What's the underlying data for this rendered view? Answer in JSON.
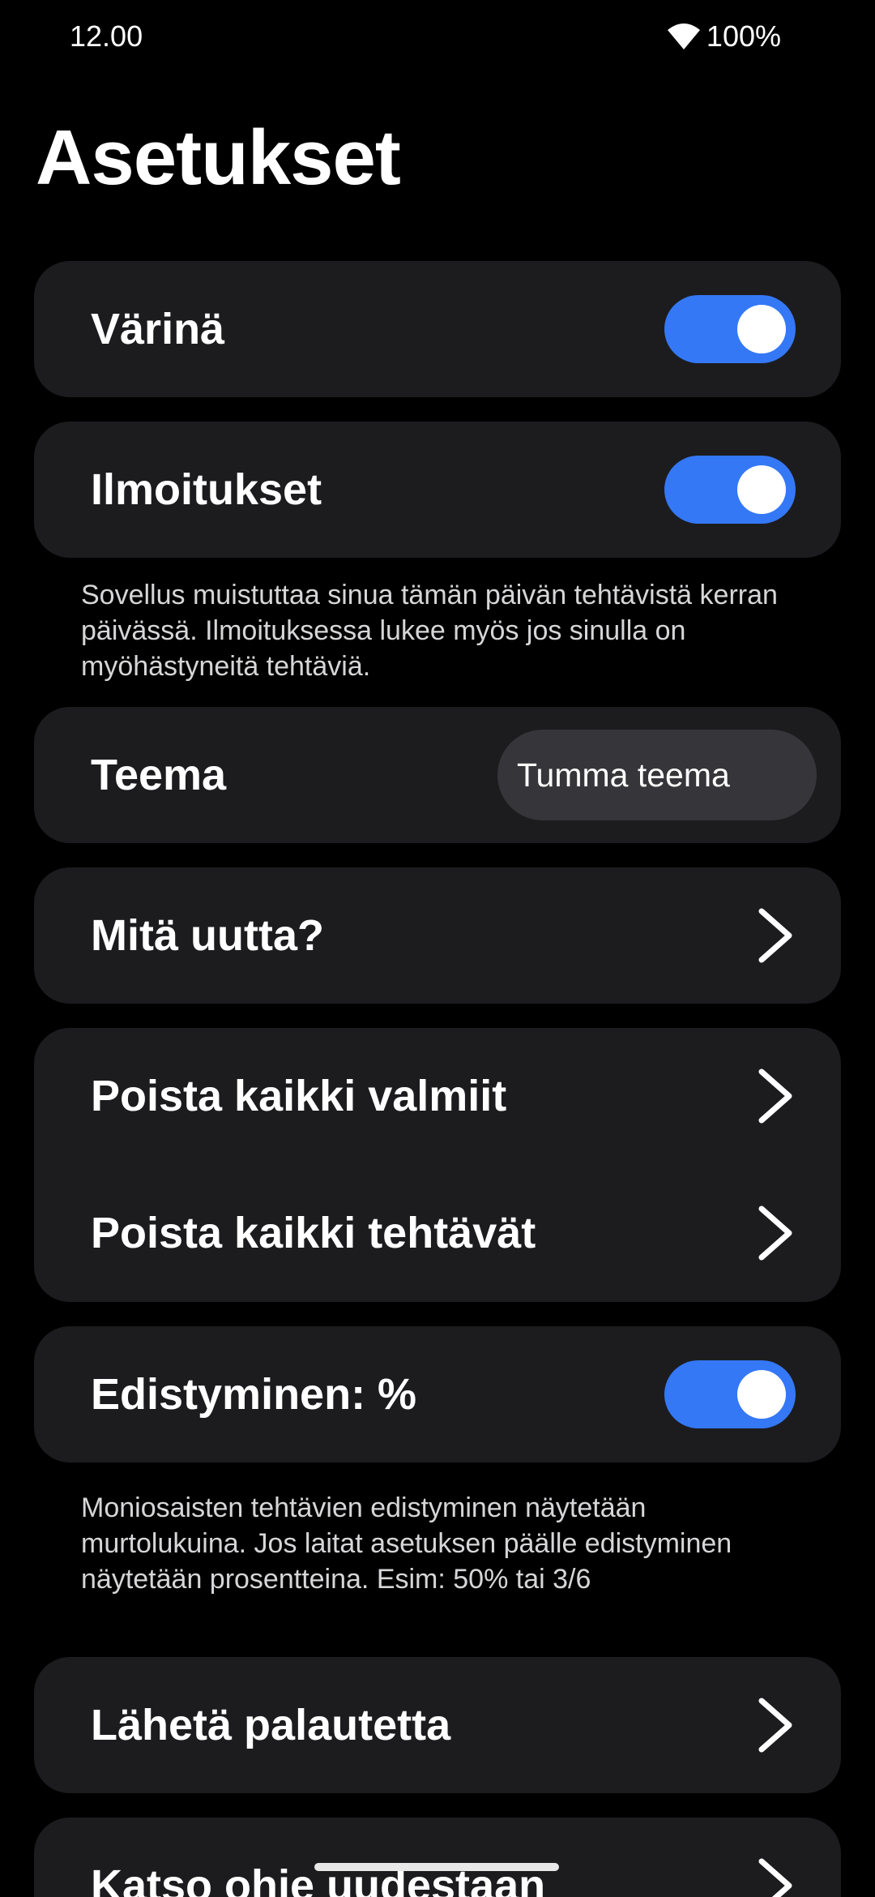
{
  "status_bar": {
    "time": "12.00",
    "battery": "100%"
  },
  "page": {
    "title": "Asetukset"
  },
  "settings": {
    "vibration": {
      "label": "Värinä",
      "enabled": true
    },
    "notifications": {
      "label": "Ilmoitukset",
      "enabled": true,
      "description": "Sovellus muistuttaa sinua tämän päivän tehtävistä kerran päivässä. Ilmoituksessa lukee myös jos sinulla on myöhästyneitä tehtäviä."
    },
    "theme": {
      "label": "Teema",
      "selected": "Tumma teema"
    },
    "whats_new": {
      "label": "Mitä uutta?"
    },
    "delete_done": {
      "label": "Poista kaikki valmiit"
    },
    "delete_all": {
      "label": "Poista kaikki tehtävät"
    },
    "progress_percent": {
      "label": "Edistyminen: %",
      "enabled": true,
      "description": "Moniosaisten tehtävien edistyminen näytetään murtolukuina. Jos laitat asetuksen päälle edistyminen näytetään prosentteina. Esim: 50% tai 3/6"
    },
    "feedback": {
      "label": "Lähetä palautetta"
    },
    "guide": {
      "label": "Katso ohje uudestaan"
    }
  },
  "colors": {
    "background": "#000000",
    "card": "#1c1c1f",
    "toggle_on": "#3478f6",
    "select_bg": "#36363a"
  },
  "icons": {
    "wifi": "wifi-icon",
    "chevron": "chevron-right-icon"
  }
}
